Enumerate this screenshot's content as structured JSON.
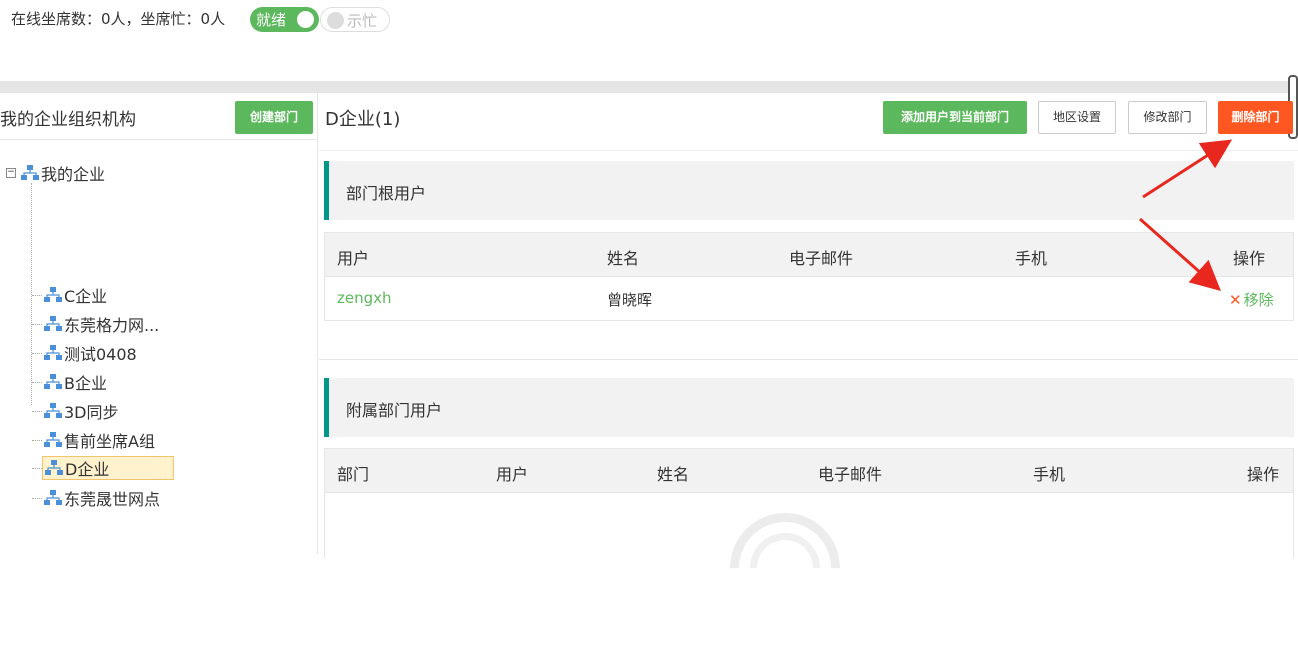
{
  "topbar": {
    "status_text": "在线坐席数：0人，坐席忙：0人",
    "ready_label": "就绪",
    "busy_label": "示忙"
  },
  "left": {
    "title": "我的企业组织机构",
    "create_button": "创建部门",
    "tree": {
      "root": "我的企业",
      "items": [
        "C企业",
        "东莞格力网...",
        "测试0408",
        "B企业",
        "3D同步",
        "售前坐席A组",
        "D企业",
        "东莞晟世网点"
      ],
      "selected": "D企业"
    }
  },
  "right": {
    "title": "D企业(1)",
    "buttons": {
      "add_user": "添加用户到当前部门",
      "region": "地区设置",
      "modify": "修改部门",
      "delete": "删除部门"
    },
    "root_users": {
      "section_title": "部门根用户",
      "columns": [
        "用户",
        "姓名",
        "电子邮件",
        "手机",
        "操作"
      ],
      "rows": [
        {
          "user": "zengxh",
          "name": "曾晓晖",
          "email": "",
          "phone": "",
          "action": "移除",
          "action_icon": "close-icon"
        }
      ]
    },
    "sub_users": {
      "section_title": "附属部门用户",
      "columns": [
        "部门",
        "用户",
        "姓名",
        "电子邮件",
        "手机",
        "操作"
      ],
      "rows": []
    }
  },
  "colors": {
    "green": "#5cb85c",
    "red": "#ff5722",
    "teal": "#009688",
    "annotation_arrow": "#e8281f"
  }
}
